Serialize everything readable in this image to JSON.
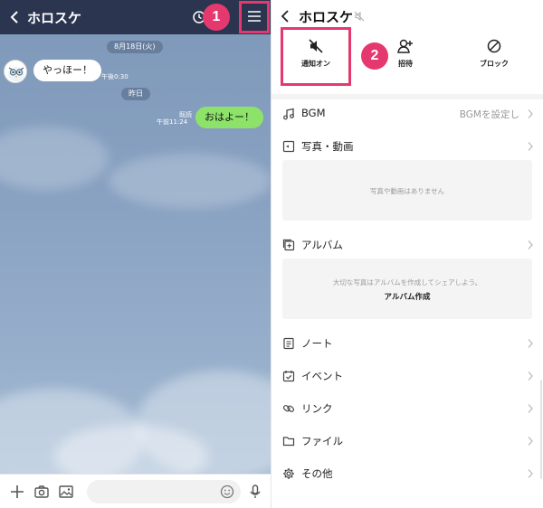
{
  "colors": {
    "header_bg": "#2b3550",
    "chat_bg": "#8aa3c3",
    "highlight": "#e5386e",
    "outgoing_bubble": "#8de36a",
    "incoming_bubble": "#ffffff"
  },
  "step_badges": [
    "1",
    "2"
  ],
  "chat": {
    "title": "ホロスケ",
    "date_1": "8月18日(火)",
    "incoming": {
      "text": "やっほー！",
      "time": "午後0:30"
    },
    "date_2": "昨日",
    "outgoing": {
      "text": "おはよー！",
      "read": "既読",
      "time": "午前11:24"
    },
    "footer_icons": [
      "plus-icon",
      "camera-icon",
      "image-icon",
      "emoji-icon",
      "mic-icon"
    ]
  },
  "settings": {
    "title": "ホロスケ",
    "actions": [
      {
        "label": "通知オン",
        "icon": "mute-icon"
      },
      {
        "label": "招待",
        "icon": "add-friend-icon"
      },
      {
        "label": "ブロック",
        "icon": "block-icon"
      }
    ],
    "bgm": {
      "label": "BGM",
      "value": "BGMを設定し"
    },
    "photos": {
      "label": "写真・動画",
      "empty": "写真や動画はありません"
    },
    "album": {
      "label": "アルバム",
      "hint": "大切な写真はアルバムを作成してシェアしよう。",
      "create": "アルバム作成"
    },
    "items": [
      {
        "label": "ノート",
        "icon": "note-icon"
      },
      {
        "label": "イベント",
        "icon": "event-icon"
      },
      {
        "label": "リンク",
        "icon": "link-icon"
      },
      {
        "label": "ファイル",
        "icon": "folder-icon"
      },
      {
        "label": "その他",
        "icon": "gear-icon"
      }
    ]
  }
}
